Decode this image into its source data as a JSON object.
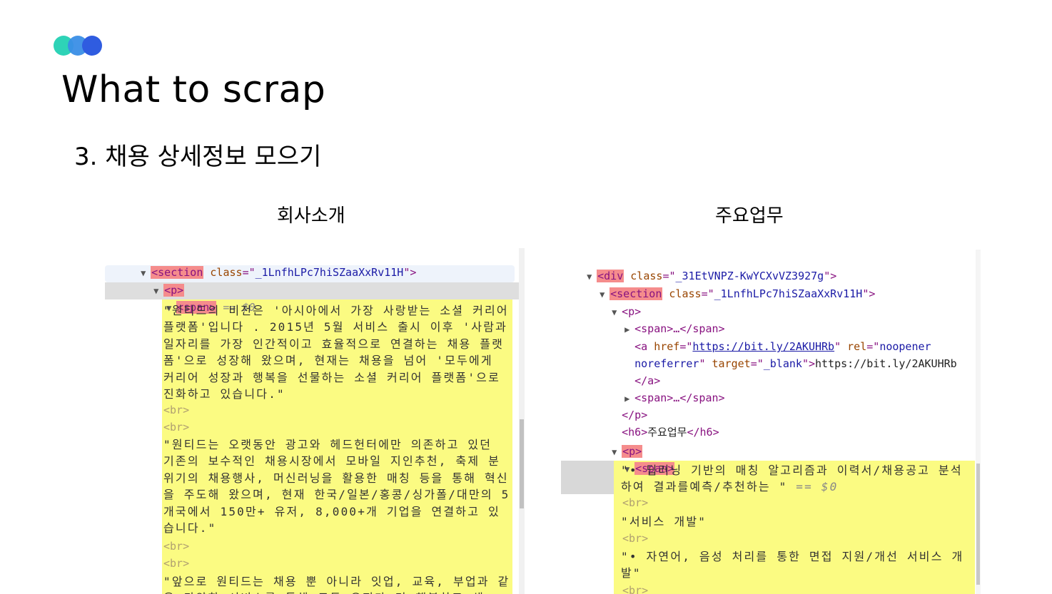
{
  "slide": {
    "title": "What to scrap",
    "subtitle": "3. 채용 상세정보 모으기",
    "left_label": "회사소개",
    "right_label": "주요업무"
  },
  "left_panel": {
    "section_tag": "<section",
    "section_attr_name": "class",
    "section_attr_rest": "=\"",
    "section_class": "_1LnfhLPc7hiSZaaXxRv11H",
    "section_close": "\">",
    "p_tag": "<p>",
    "span_tag": "<span>",
    "selected_marker": "== $0",
    "para1": "\"원티드의 비전은 '아시아에서 가장 사랑받는 소셜 커리어 플랫폼'입니다 . 2015년 5월 서비스 출시 이후 '사람과 일자리를 가장 인간적이고 효율적으로 연결하는 채용 플랫폼'으로 성장해 왔으며, 현재는 채용을 넘어 '모두에게 커리어 성장과 행복을 선물하는 소셜 커리어 플랫폼'으로 진화하고 있습니다.\"",
    "br": "<br>",
    "para2": "\"원티드는 오랫동안 광고와 헤드헌터에만 의존하고 있던 기존의 보수적인 채용시장에서 모바일 지인추천, 축제 분위기의 채용행사, 머신러닝을 활용한 매칭 등을 통해 혁신을 주도해 왔으며, 현재 한국/일본/홍콩/싱가폴/대만의 5개국에서 150만+ 유저, 8,000+개 기업을 연결하고 있습니다.\"",
    "para3": "\"앞으로 원티드는 채용 뿐 아니라 잇업, 교육, 부업과 같은 다양한 서비스를 통해 모든 유저가 더 행복하고 생"
  },
  "right_panel": {
    "div_tag": "<div",
    "div_attr_name": "class",
    "div_class": "_31EtVNPZ-KwYCXvVZ3927g",
    "section_tag": "<section",
    "section_attr_name": "class",
    "section_class": "_1LnfhLPc7hiSZaaXxRv11H",
    "p_open": "<p>",
    "span_collapsed": "<span>…</span>",
    "a_open": "<a",
    "href_name": "href",
    "href_value": "https://bit.ly/2AKUHRb",
    "rel_name": "rel",
    "rel_value_1": "noopener",
    "rel_value_2": "noreferrer",
    "target_name": "target",
    "target_value": "_blank",
    "a_text": "https://bit.ly/2AKUHRb",
    "a_close": "</a>",
    "p_close": "</p>",
    "h6_open": "<h6>",
    "h6_text": "주요업무",
    "h6_close": "</h6>",
    "p_tag": "<p>",
    "span_tag": "<span>",
    "item1": "\"• 딥러닝 기반의 매칭 알고리즘과 이력서/채용공고 분석하여 결과를예측/추천하는 \"",
    "selected_marker": "== $0",
    "br": "<br>",
    "item2": "\"서비스 개발\"",
    "item3": "\"• 자연어, 음성 처리를 통한 면접 지원/개선 서비스 개발\""
  },
  "colors": {
    "tag_highlight": "#f58c8c",
    "text_highlight": "#fbfb82",
    "dot1": "#2ed3b7",
    "dot2": "#3a8ee6",
    "dot3": "#2f5ce0"
  }
}
